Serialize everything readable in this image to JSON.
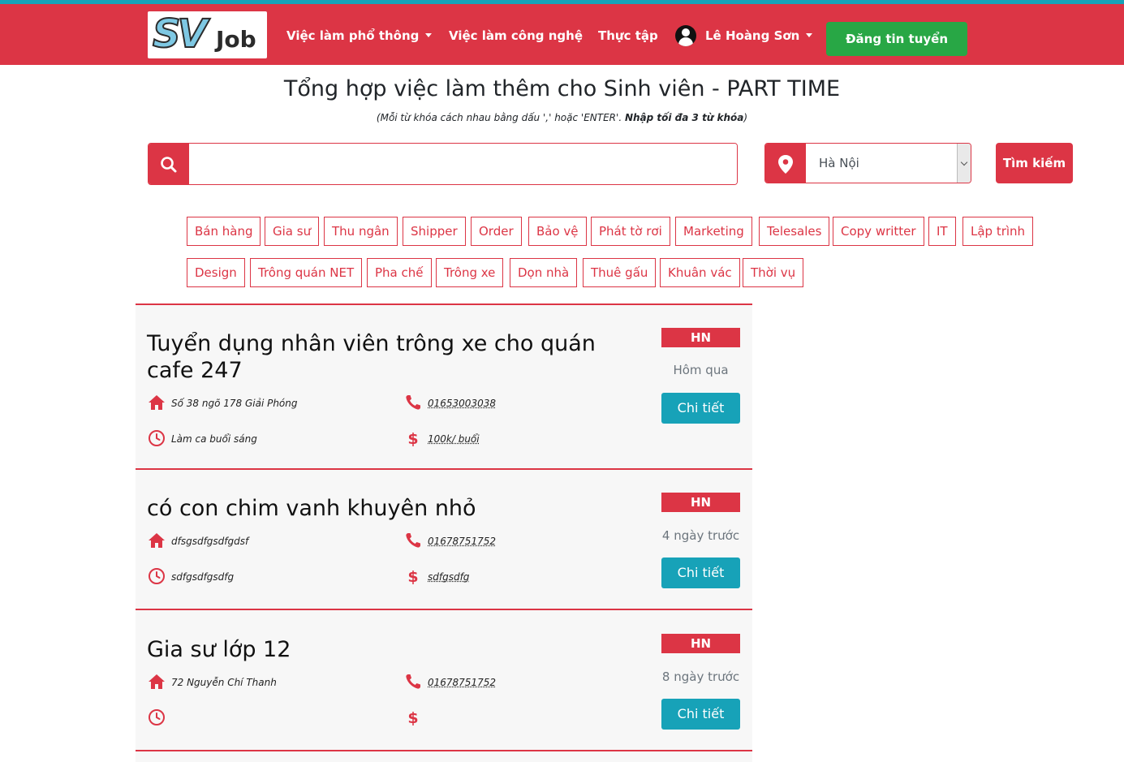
{
  "nav": {
    "logo_sv": "SV",
    "logo_job": "Job",
    "item_common_jobs": "Việc làm phổ thông",
    "item_tech_jobs": "Việc làm công nghệ",
    "item_internship": "Thực tập",
    "user_name": "Lê Hoàng Sơn",
    "post_job": "Đăng tin tuyển dụng"
  },
  "heading": {
    "title": "Tổng hợp việc làm thêm cho Sinh viên - PART TIME",
    "hint_prefix": "(Mỗi từ khóa cách nhau bằng dấu ',' hoặc 'ENTER'. ",
    "hint_bold": "Nhập tối đa 3 từ khóa",
    "hint_suffix": ")"
  },
  "search": {
    "keyword_value": "",
    "location": "Hà Nội",
    "button": "Tìm kiếm"
  },
  "tags": [
    "Bán hàng",
    "Gia sư",
    "Thu ngân",
    "Shipper",
    "Order",
    "Bảo vệ",
    "Phát tờ rơi",
    "Marketing",
    "Telesales",
    "Copy writter",
    "IT",
    "Lập trình",
    "Design",
    "Trông quán NET",
    "Pha chế",
    "Trông xe",
    "Dọn nhà",
    "Thuê gấu",
    "Khuân vác",
    "Thời vụ"
  ],
  "jobs": [
    {
      "title": "Tuyển dụng nhân viên trông xe cho quán cafe 247",
      "address": "Số 38 ngõ 178 Giải Phóng",
      "phone": "01653003038",
      "schedule": "Làm ca buổi sáng",
      "salary": "100k/ buổi",
      "region": "HN",
      "time": "Hôm qua",
      "button": "Chi tiết"
    },
    {
      "title": "có con chim vanh khuyên nhỏ",
      "address": "dfsgsdfgsdfgdsf",
      "phone": "01678751752",
      "schedule": "sdfgsdfgsdfg",
      "salary": "sdfgsdfg",
      "region": "HN",
      "time": "4 ngày trước",
      "button": "Chi tiết"
    },
    {
      "title": "Gia sư lớp 12",
      "address": "72 Nguyễn Chí Thanh",
      "phone": "01678751752",
      "schedule": "",
      "salary": "",
      "region": "HN",
      "time": "8 ngày trước",
      "button": "Chi tiết"
    }
  ],
  "colors": {
    "brand_red": "#dc3545",
    "accent_teal": "#17a2b8",
    "success_green": "#28a745"
  },
  "icons": [
    "search-icon",
    "map-marker-icon",
    "user-avatar-icon",
    "home-icon",
    "phone-icon",
    "clock-icon",
    "dollar-icon"
  ]
}
